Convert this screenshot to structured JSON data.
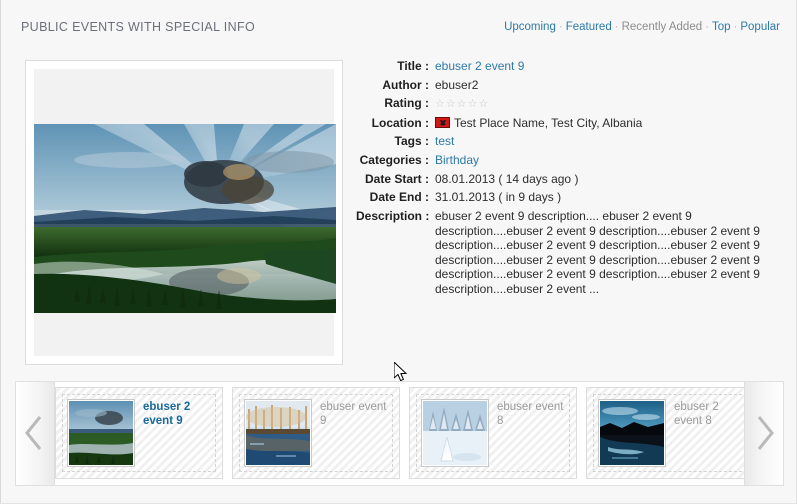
{
  "header": {
    "title": "PUBLIC EVENTS WITH SPECIAL INFO",
    "links": [
      {
        "label": "Upcoming",
        "state": "link"
      },
      {
        "label": "Featured",
        "state": "link"
      },
      {
        "label": "Recently Added",
        "state": "muted"
      },
      {
        "label": "Top",
        "state": "link"
      },
      {
        "label": "Popular",
        "state": "link"
      }
    ],
    "separator": "·"
  },
  "details": {
    "labels": {
      "title": "Title :",
      "author": "Author :",
      "rating": "Rating :",
      "location": "Location :",
      "tags": "Tags :",
      "categories": "Categories :",
      "date_start": "Date Start :",
      "date_end": "Date End :",
      "description": "Description :"
    },
    "title": "ebuser 2 event 9",
    "author": "ebuser2",
    "rating": {
      "stars": "☆☆☆☆☆",
      "value": 0,
      "max": 5
    },
    "location": {
      "flag_icon": "albania-flag-icon",
      "text": "Test Place Name, Test City, Albania"
    },
    "tags": "test",
    "categories": "Birthday",
    "date_start": "08.01.2013 ( 14 days ago )",
    "date_end": "31.01.2013 ( in 9 days )",
    "description": "ebuser 2 event 9 description.... ebuser 2 event 9 description....ebuser 2 event 9 description....ebuser 2 event 9 description....ebuser 2 event 9 description....ebuser 2 event 9 description....ebuser 2 event 9 description....ebuser 2 event 9 description....ebuser 2 event 9 description....ebuser 2 event 9 description....ebuser 2 event ..."
  },
  "carousel": {
    "prev_label": "‹",
    "next_label": "›",
    "items": [
      {
        "label": "ebuser 2 event 9",
        "selected": true,
        "image": "sunset-lake-landscape"
      },
      {
        "label": "ebuser event 9",
        "selected": false,
        "image": "autumn-river-trees"
      },
      {
        "label": "ebuser event 8",
        "selected": false,
        "image": "snow-forest-winter"
      },
      {
        "label": "ebuser 2 event 8",
        "selected": false,
        "image": "night-lake-reflection"
      }
    ]
  },
  "colors": {
    "link": "#2d7aa5",
    "selected_thumb_text": "#19699c",
    "header_text": "#6b7078",
    "page_background": "#f7f7f7"
  }
}
